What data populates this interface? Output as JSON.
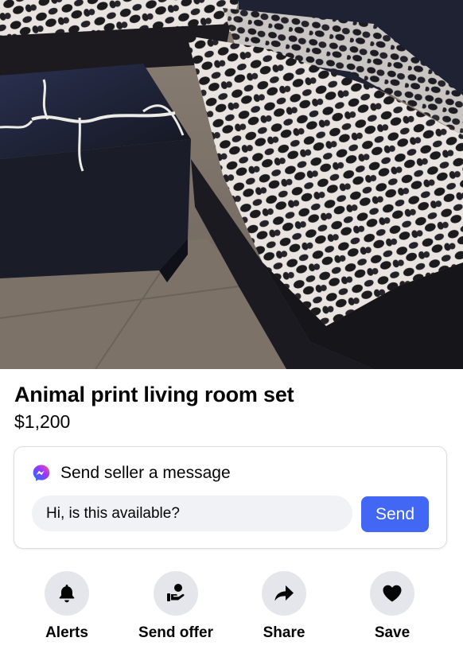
{
  "listing": {
    "image_alt": "Animal print living room set photo",
    "title": "Animal print living room set",
    "price": "$1,200"
  },
  "message": {
    "heading": "Send seller a message",
    "input_value": "Hi, is this available?",
    "send_label": "Send",
    "icon": "messenger-icon"
  },
  "actions": [
    {
      "label": "Alerts",
      "icon": "bell-icon"
    },
    {
      "label": "Send offer",
      "icon": "offer-icon"
    },
    {
      "label": "Share",
      "icon": "share-arrow-icon"
    },
    {
      "label": "Save",
      "icon": "heart-icon"
    }
  ],
  "colors": {
    "send_button": "#4267f5",
    "icon_circle": "#e4e6eb",
    "input_bg": "#f0f2f5"
  }
}
